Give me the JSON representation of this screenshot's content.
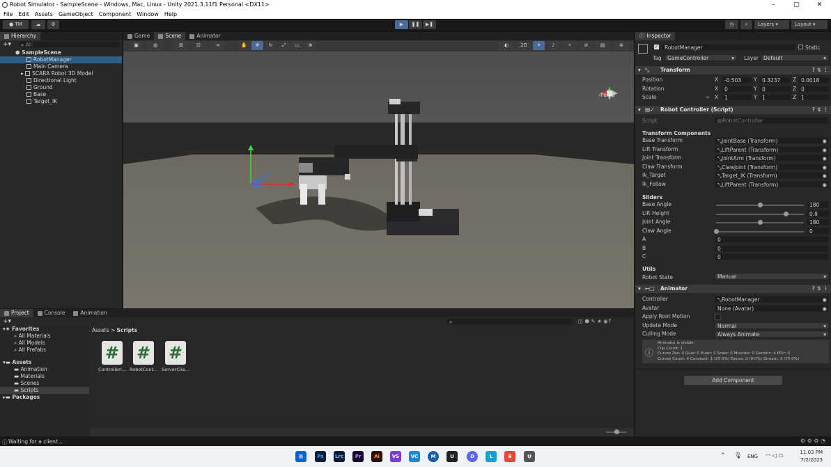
{
  "window": {
    "title": "Robot Simulator - SampleScene - Windows, Mac, Linux - Unity 2021.3.11f1 Personal <DX11>",
    "min": "–",
    "max": "▢",
    "close": "✕"
  },
  "menu": [
    "File",
    "Edit",
    "Assets",
    "GameObject",
    "Component",
    "Window",
    "Help"
  ],
  "toolbar": {
    "account": "TM",
    "play": "▶",
    "pause": "❚❚",
    "step": "▶❚",
    "layers": "Layers",
    "layout": "Layout"
  },
  "hierarchy": {
    "tab": "Hierarchy",
    "search_placeholder": "All",
    "scene": "SampleScene",
    "items": [
      "RobotManager",
      "Main Camera",
      "SCARA Robot 3D Model",
      "Directional Light",
      "Ground",
      "Base",
      "Target_IK"
    ]
  },
  "center_tabs": [
    "Game",
    "Scene",
    "Animator"
  ],
  "scene_view": {
    "mode2d": "2D",
    "persp": "Persp"
  },
  "project": {
    "tabs": [
      "Project",
      "Console",
      "Animation"
    ],
    "favorites": "Favorites",
    "fav_items": [
      "All Materials",
      "All Models",
      "All Prefabs"
    ],
    "assets": "Assets",
    "asset_folders": [
      "Animation",
      "Materials",
      "Scenes",
      "Scripts"
    ],
    "packages": "Packages",
    "breadcrumb": [
      "Assets",
      "Scripts"
    ],
    "breadcrumb_sep": ">",
    "files": [
      "ControllerI...",
      "RobotCont...",
      "ServerClie..."
    ],
    "file_glyph": "#",
    "count": "7"
  },
  "inspector": {
    "tab": "Inspector",
    "object_name": "RobotManager",
    "static": "Static",
    "tag_label": "Tag",
    "tag": "GameController",
    "layer_label": "Layer",
    "layer": "Default",
    "transform": {
      "title": "Transform",
      "rows": [
        {
          "label": "Position",
          "x": "-0.503",
          "y": "0.3237",
          "z": "0.0018"
        },
        {
          "label": "Rotation",
          "x": "0",
          "y": "0",
          "z": "0"
        },
        {
          "label": "Scale",
          "x": "1",
          "y": "1",
          "z": "1"
        }
      ]
    },
    "robot_controller": {
      "title": "Robot Controller (Script)",
      "script_label": "Script",
      "script": "RobotController",
      "section1": "Transform Components",
      "refs": [
        {
          "label": "Base Transform",
          "value": "JointBase (Transform)"
        },
        {
          "label": "Lift Transform",
          "value": "LiftParent (Transform)"
        },
        {
          "label": "Joint Transform",
          "value": "JointArm (Transform)"
        },
        {
          "label": "Claw Transform",
          "value": "ClawJoint (Transform)"
        },
        {
          "label": "Ik_Target",
          "value": "Target_IK (Transform)"
        },
        {
          "label": "Ik_Follow",
          "value": "LiftParent (Transform)"
        }
      ],
      "section2": "Sliders",
      "sliders": [
        {
          "label": "Base Angle",
          "value": "180",
          "fraction": 0.5
        },
        {
          "label": "Lift Height",
          "value": "0.8",
          "fraction": 0.8
        },
        {
          "label": "Joint Angle",
          "value": "180",
          "fraction": 0.5
        },
        {
          "label": "Claw Angle",
          "value": "0",
          "fraction": 0.0
        }
      ],
      "plain": [
        {
          "label": "A",
          "value": "0"
        },
        {
          "label": "B",
          "value": "0"
        },
        {
          "label": "C",
          "value": "0"
        }
      ],
      "section3": "Utils",
      "robot_state_label": "Robot State",
      "robot_state": "Manual"
    },
    "animator": {
      "title": "Animator",
      "rows": [
        {
          "label": "Controller",
          "value": "RobotManager"
        },
        {
          "label": "Avatar",
          "value": "None (Avatar)"
        }
      ],
      "apply_root_motion": "Apply Root Motion",
      "update_mode_label": "Update Mode",
      "update_mode": "Normal",
      "culling_label": "Culling Mode",
      "culling": "Always Animate",
      "info": [
        "Animator is visible",
        "Clip Count: 1",
        "Curves Pos: 0 Quat: 0 Euler: 0 Scale: 0 Muscles: 0 Generic: 4 PPtr: 0",
        "Curves Count: 4 Constant: 1 (25.0%) Dense: 0 (0.0%) Stream: 3 (75.0%)"
      ]
    },
    "add_component": "Add Component"
  },
  "status": "Waiting for a client...",
  "taskbar": {
    "apps": [
      "Ps",
      "Lrc",
      "Pr",
      "Ai",
      "VS",
      "VC",
      "M",
      "U",
      "D",
      "L",
      "B",
      "U"
    ],
    "lang": "ENG",
    "time": "11:03 PM",
    "date": "7/2/2023"
  }
}
